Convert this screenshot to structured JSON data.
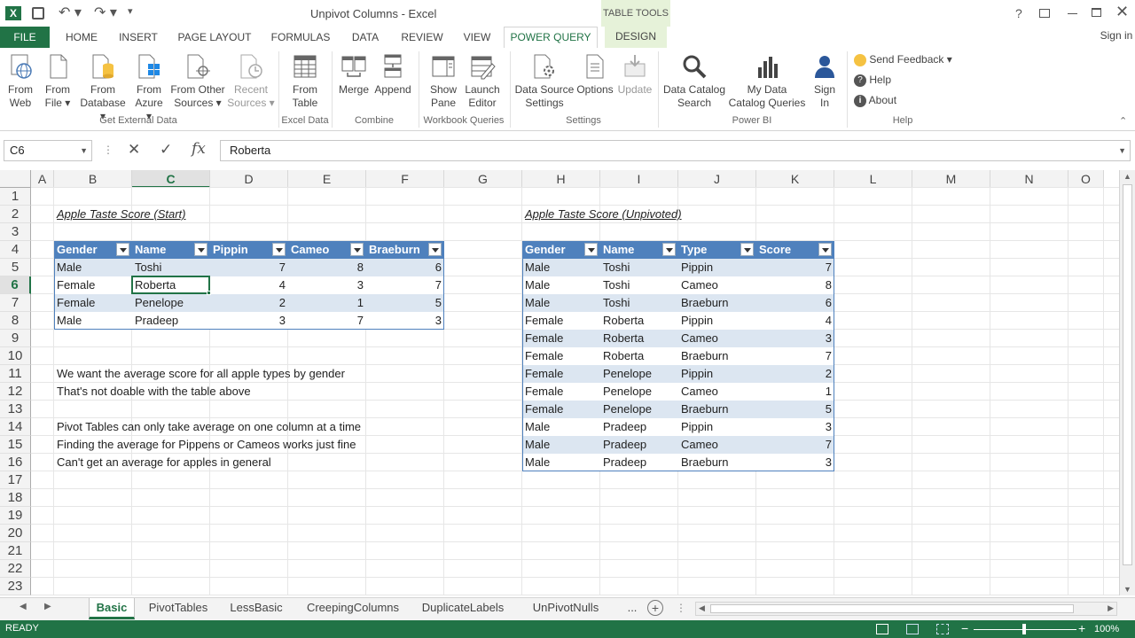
{
  "window": {
    "title": "Unpivot Columns - Excel",
    "table_tools": "TABLE TOOLS",
    "sign_in": "Sign in",
    "help_q": "?"
  },
  "tabs": [
    {
      "label": "FILE"
    },
    {
      "label": "HOME"
    },
    {
      "label": "INSERT"
    },
    {
      "label": "PAGE LAYOUT"
    },
    {
      "label": "FORMULAS"
    },
    {
      "label": "DATA"
    },
    {
      "label": "REVIEW"
    },
    {
      "label": "VIEW"
    },
    {
      "label": "POWER QUERY"
    },
    {
      "label": "DESIGN"
    }
  ],
  "ribbon": {
    "buttons": [
      {
        "label1": "From",
        "label2": "Web"
      },
      {
        "label1": "From",
        "label2": "File ▾"
      },
      {
        "label1": "From",
        "label2": "Database ▾"
      },
      {
        "label1": "From",
        "label2": "Azure ▾"
      },
      {
        "label1": "From Other",
        "label2": "Sources ▾"
      },
      {
        "label1": "Recent",
        "label2": "Sources ▾"
      },
      {
        "label1": "From",
        "label2": "Table"
      },
      {
        "label1": "Merge",
        "label2": ""
      },
      {
        "label1": "Append",
        "label2": ""
      },
      {
        "label1": "Show",
        "label2": "Pane"
      },
      {
        "label1": "Launch",
        "label2": "Editor"
      },
      {
        "label1": "Data Source",
        "label2": "Settings"
      },
      {
        "label1": "Options",
        "label2": ""
      },
      {
        "label1": "Update",
        "label2": ""
      },
      {
        "label1": "Data Catalog",
        "label2": "Search"
      },
      {
        "label1": "My Data",
        "label2": "Catalog Queries"
      },
      {
        "label1": "Sign",
        "label2": "In"
      }
    ],
    "groups": [
      {
        "label": "Get External Data"
      },
      {
        "label": "Excel Data"
      },
      {
        "label": "Combine"
      },
      {
        "label": "Workbook Queries"
      },
      {
        "label": "Settings"
      },
      {
        "label": "Power BI"
      },
      {
        "label": "Help"
      }
    ],
    "help_items": [
      {
        "label": "Send Feedback ▾"
      },
      {
        "label": "Help"
      },
      {
        "label": "About"
      }
    ]
  },
  "formula": {
    "name_box": "C6",
    "fx": "fx",
    "value": "Roberta"
  },
  "columns": [
    "A",
    "B",
    "C",
    "D",
    "E",
    "F",
    "G",
    "H",
    "I",
    "J",
    "K",
    "L",
    "M",
    "N",
    "O"
  ],
  "rows": [
    "1",
    "2",
    "3",
    "4",
    "5",
    "6",
    "7",
    "8",
    "9",
    "10",
    "11",
    "12",
    "13",
    "14",
    "15",
    "16",
    "17",
    "18",
    "19",
    "20",
    "21",
    "22",
    "23"
  ],
  "sheet": {
    "title_start": "Apple Taste Score (Start)",
    "title_unpivot": "Apple Taste Score (Unpivoted)",
    "table1": {
      "headers": [
        "Gender",
        "Name",
        "Pippin",
        "Cameo",
        "Braeburn"
      ],
      "rows": [
        [
          "Male",
          "Toshi",
          "7",
          "8",
          "6"
        ],
        [
          "Female",
          "Roberta",
          "4",
          "3",
          "7"
        ],
        [
          "Female",
          "Penelope",
          "2",
          "1",
          "5"
        ],
        [
          "Male",
          "Pradeep",
          "3",
          "7",
          "3"
        ]
      ]
    },
    "table2": {
      "headers": [
        "Gender",
        "Name",
        "Type",
        "Score"
      ],
      "rows": [
        [
          "Male",
          "Toshi",
          "Pippin",
          "7"
        ],
        [
          "Male",
          "Toshi",
          "Cameo",
          "8"
        ],
        [
          "Male",
          "Toshi",
          "Braeburn",
          "6"
        ],
        [
          "Female",
          "Roberta",
          "Pippin",
          "4"
        ],
        [
          "Female",
          "Roberta",
          "Cameo",
          "3"
        ],
        [
          "Female",
          "Roberta",
          "Braeburn",
          "7"
        ],
        [
          "Female",
          "Penelope",
          "Pippin",
          "2"
        ],
        [
          "Female",
          "Penelope",
          "Cameo",
          "1"
        ],
        [
          "Female",
          "Penelope",
          "Braeburn",
          "5"
        ],
        [
          "Male",
          "Pradeep",
          "Pippin",
          "3"
        ],
        [
          "Male",
          "Pradeep",
          "Cameo",
          "7"
        ],
        [
          "Male",
          "Pradeep",
          "Braeburn",
          "3"
        ]
      ]
    },
    "notes": [
      "We want the average score for all apple types by gender",
      "That's not doable with the table above",
      "",
      "Pivot Tables can only take average on one column at a time",
      "Finding the average for Pippens or Cameos works just fine",
      "Can't get an average for apples in general"
    ]
  },
  "sheet_tabs": [
    {
      "label": "Basic"
    },
    {
      "label": "PivotTables"
    },
    {
      "label": "LessBasic"
    },
    {
      "label": "CreepingColumns"
    },
    {
      "label": "DuplicateLabels"
    },
    {
      "label": "UnPivotNulls"
    },
    {
      "label": "..."
    }
  ],
  "status": {
    "ready": "READY",
    "zoom": "100%"
  },
  "colors": {
    "excel_green": "#217346",
    "table_header": "#4f81bd",
    "band_row": "#dce6f1",
    "pq_tab": "#d9ead3"
  }
}
